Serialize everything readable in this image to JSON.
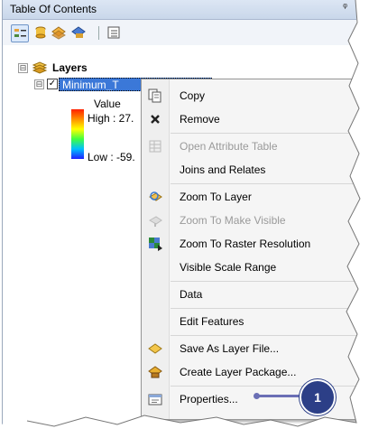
{
  "window": {
    "title": "Table Of Contents",
    "pin_glyph": "ᵠ"
  },
  "toolbar": {
    "buttons": [
      "list-by-drawing-order-icon",
      "list-by-source-icon",
      "list-by-visibility-icon",
      "list-by-selection-icon",
      "options-icon"
    ]
  },
  "tree": {
    "root_expander": "⊟",
    "root_label": "Layers",
    "layer": {
      "expander": "⊟",
      "checked": true,
      "name": "Minimum_T",
      "legend_title": "Value",
      "high_label": "High : 27.",
      "low_label": "Low : -59."
    }
  },
  "context_menu": {
    "items": [
      {
        "label": "Copy",
        "icon": "copy-icon",
        "enabled": true,
        "submenu": false
      },
      {
        "label": "Remove",
        "icon": "remove-icon",
        "enabled": true,
        "submenu": false
      },
      {
        "label": "Open Attribute Table",
        "icon": "table-icon",
        "enabled": false,
        "submenu": false
      },
      {
        "label": "Joins and Relates",
        "icon": "",
        "enabled": true,
        "submenu": true
      },
      {
        "label": "Zoom To Layer",
        "icon": "zoom-to-layer-icon",
        "enabled": true,
        "submenu": false
      },
      {
        "label": "Zoom To Make Visible",
        "icon": "zoom-visible-icon",
        "enabled": false,
        "submenu": false
      },
      {
        "label": "Zoom To Raster Resolution",
        "icon": "raster-resolution-icon",
        "enabled": true,
        "submenu": false
      },
      {
        "label": "Visible Scale Range",
        "icon": "",
        "enabled": true,
        "submenu": true
      },
      {
        "label": "Data",
        "icon": "",
        "enabled": true,
        "submenu": true
      },
      {
        "label": "Edit Features",
        "icon": "",
        "enabled": true,
        "submenu": true
      },
      {
        "label": "Save As Layer File...",
        "icon": "layer-file-icon",
        "enabled": true,
        "submenu": false
      },
      {
        "label": "Create Layer Package...",
        "icon": "layer-package-icon",
        "enabled": true,
        "submenu": false
      },
      {
        "label": "Properties...",
        "icon": "properties-icon",
        "enabled": true,
        "submenu": false
      }
    ]
  },
  "callout": {
    "number": "1"
  },
  "colors": {
    "selection": "#3b78d8",
    "callout": "#2c3f87",
    "callout_line": "#6b6fb5"
  }
}
